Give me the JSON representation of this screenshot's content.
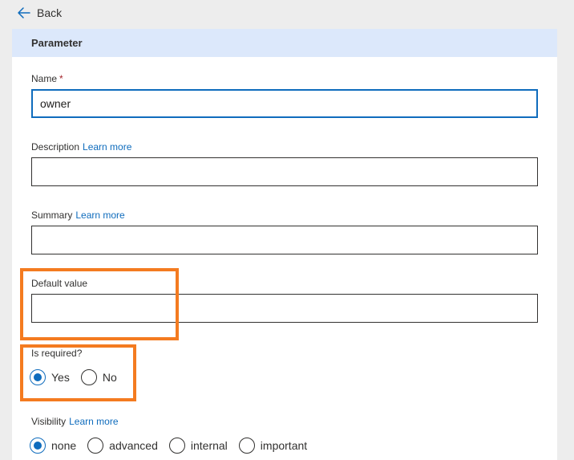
{
  "nav": {
    "back_label": "Back"
  },
  "panel": {
    "title": "Parameter"
  },
  "fields": {
    "name": {
      "label": "Name",
      "required_mark": "*",
      "value": "owner"
    },
    "description": {
      "label": "Description",
      "link": "Learn more",
      "value": ""
    },
    "summary": {
      "label": "Summary",
      "link": "Learn more",
      "value": ""
    },
    "default_value": {
      "label": "Default value",
      "value": ""
    }
  },
  "is_required": {
    "label": "Is required?",
    "options": [
      "Yes",
      "No"
    ],
    "selected": "Yes"
  },
  "visibility": {
    "label": "Visibility",
    "link": "Learn more",
    "options": [
      "none",
      "advanced",
      "internal",
      "important"
    ],
    "selected": "none"
  },
  "colors": {
    "accent": "#0f6cbd",
    "header_bg": "#dce8fb",
    "highlight": "#f47b20",
    "page_bg": "#ededed"
  }
}
